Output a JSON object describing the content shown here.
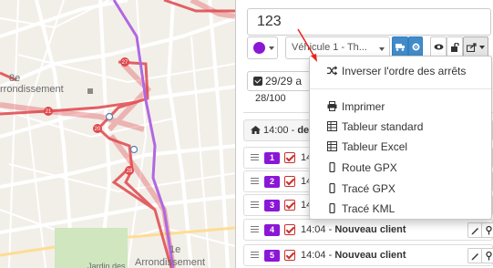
{
  "map": {
    "labels": {
      "arr8_number": "8e",
      "arr8_word": "rrondissement",
      "arr1_number": "1e",
      "arr1_word": "Arrondissement",
      "park": "Jardin des"
    },
    "markers": [
      "27",
      "21",
      "20",
      "28"
    ],
    "colors": {
      "land": "#f2efe9",
      "route": "#e0474c",
      "route_path": "#b068e0"
    }
  },
  "panel": {
    "tour_name": "123",
    "color_picker": {
      "color": "#8b17d6"
    },
    "vehicle_select": {
      "value": "Véhicule 1 - Th..."
    },
    "toolbar": {
      "truck_icon": "truck-icon",
      "settings_icon": "gear-icon",
      "eye_icon": "eye-icon",
      "lock_icon": "unlock-icon",
      "export_icon": "share-icon"
    },
    "stops_selected": "29/29 a",
    "weight": "28/100",
    "start": {
      "time": "14:00 - ",
      "label": "de"
    },
    "stops": [
      {
        "number": "1",
        "time": "14",
        "label": ""
      },
      {
        "number": "2",
        "time": "14",
        "label": ""
      },
      {
        "number": "3",
        "time": "14",
        "label": ""
      },
      {
        "number": "4",
        "time": "14:04 - ",
        "label": "Nouveau client"
      },
      {
        "number": "5",
        "time": "14:04 - ",
        "label": "Nouveau client"
      }
    ],
    "accent": "#8b17d6",
    "primary": "#428bca"
  },
  "dropdown": {
    "reverse": "Inverser l'ordre des arrêts",
    "print": "Imprimer",
    "table_standard": "Tableur standard",
    "table_excel": "Tableur Excel",
    "route_gpx": "Route GPX",
    "trace_gpx": "Tracé GPX",
    "trace_kml": "Tracé KML"
  }
}
